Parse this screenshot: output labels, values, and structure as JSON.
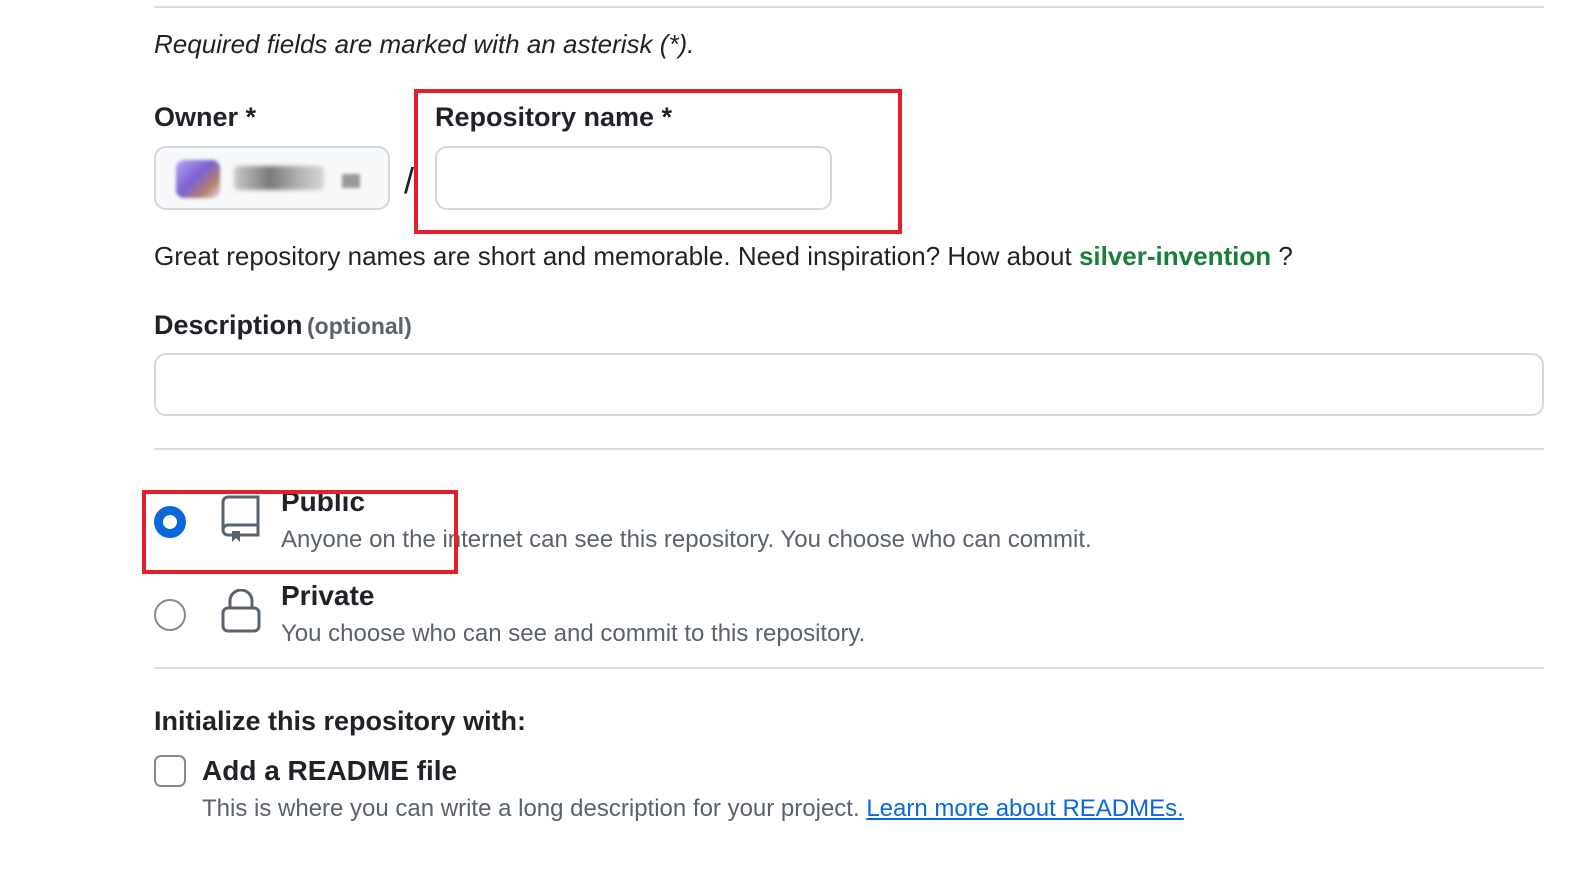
{
  "required_note": "Required fields are marked with an asterisk (*).",
  "owner": {
    "label": "Owner *",
    "value": ""
  },
  "separator": "/",
  "repo_name": {
    "label": "Repository name *",
    "value": "",
    "placeholder": ""
  },
  "inspiration": {
    "text": "Great repository names are short and memorable. Need inspiration? How about",
    "suggestion": "silver-invention",
    "suffix": "?"
  },
  "description": {
    "label": "Description",
    "optional": "(optional)",
    "value": "",
    "placeholder": ""
  },
  "visibility": {
    "options": [
      {
        "title": "Public",
        "description": "Anyone on the internet can see this repository. You choose who can commit.",
        "selected": true,
        "icon": "repo-icon"
      },
      {
        "title": "Private",
        "description": "You choose who can see and commit to this repository.",
        "selected": false,
        "icon": "lock-icon"
      }
    ]
  },
  "initialize": {
    "heading": "Initialize this repository with:",
    "readme": {
      "label": "Add a README file",
      "description": "This is where you can write a long description for your project.",
      "link": "Learn more about READMEs.",
      "checked": false
    }
  },
  "colors": {
    "accent_blue": "#0969da",
    "suggestion_green": "#1a7f37",
    "annotation_red": "#e0202a"
  }
}
